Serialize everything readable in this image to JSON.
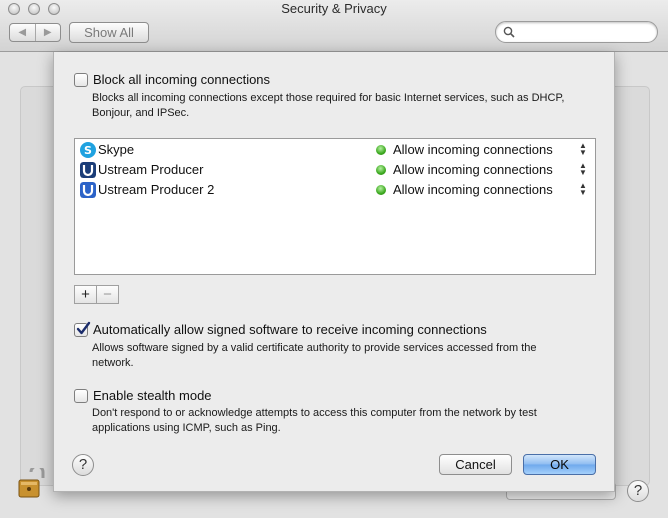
{
  "window": {
    "title": "Security & Privacy",
    "show_all_label": "Show All",
    "search_placeholder": ""
  },
  "sheet": {
    "block_all": {
      "label": "Block all incoming connections",
      "checked": false,
      "description": "Blocks all incoming connections except those required for basic Internet services, such as DHCP, Bonjour, and IPSec."
    },
    "apps": [
      {
        "name": "Skype",
        "icon": "skype-icon",
        "status": "Allow incoming connections",
        "status_color": "#3ca91f"
      },
      {
        "name": "Ustream Producer",
        "icon": "ustream-icon",
        "status": "Allow incoming connections",
        "status_color": "#3ca91f"
      },
      {
        "name": "Ustream Producer 2",
        "icon": "ustream-icon",
        "status": "Allow incoming connections",
        "status_color": "#3ca91f"
      }
    ],
    "add_label": "+",
    "remove_label": "−",
    "auto_allow": {
      "label": "Automatically allow signed software to receive incoming connections",
      "checked": true,
      "description": "Allows software signed by a valid certificate authority to provide services accessed from the network."
    },
    "stealth": {
      "label": "Enable stealth mode",
      "checked": false,
      "description": "Don't respond to or acknowledge attempts to access this computer from the network by test applications using ICMP, such as Ping."
    },
    "help_label": "?",
    "cancel_label": "Cancel",
    "ok_label": "OK"
  },
  "footer": {
    "help_label": "?"
  },
  "colors": {
    "ok_button": "#8ebcf1",
    "status_green": "#3ca91f"
  }
}
